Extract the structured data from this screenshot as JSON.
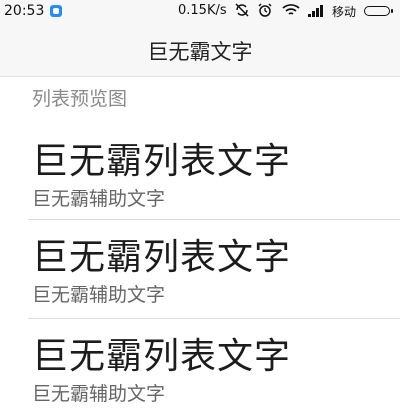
{
  "status_bar": {
    "time": "20:53",
    "network_speed": "0.15K/s",
    "carrier": "移动",
    "icons": [
      "app-notification-icon",
      "no-sync-icon",
      "alarm-icon",
      "wifi-icon",
      "signal-icon",
      "battery-icon"
    ]
  },
  "title_bar": {
    "title": "巨无霸文字"
  },
  "list": {
    "section_header": "列表预览图",
    "items": [
      {
        "primary": "巨无霸列表文字",
        "secondary": "巨无霸辅助文字"
      },
      {
        "primary": "巨无霸列表文字",
        "secondary": "巨无霸辅助文字"
      },
      {
        "primary": "巨无霸列表文字",
        "secondary": "巨无霸辅助文字"
      }
    ]
  }
}
